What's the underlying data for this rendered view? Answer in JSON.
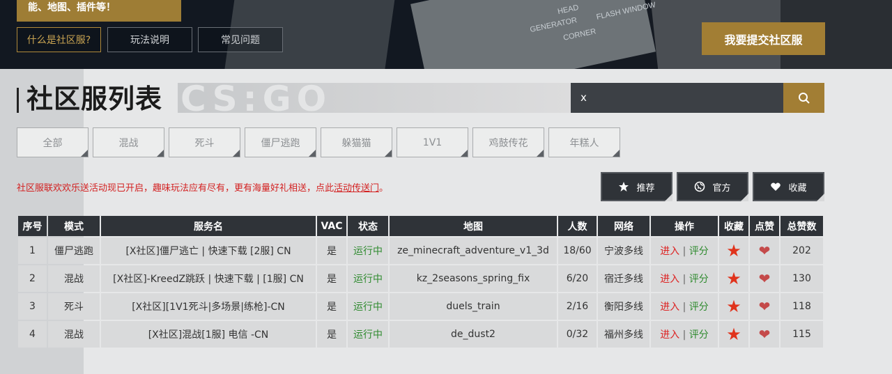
{
  "header": {
    "tagline": "能、地图、插件等！",
    "tabs": [
      "什么是社区服?",
      "玩法说明",
      "常见问题"
    ],
    "submit_label": "我要提交社区服",
    "room_labels": [
      "GENERATOR",
      "HEAD",
      "FLASH WINDOW",
      "CORNER"
    ]
  },
  "main": {
    "title": "社区服列表",
    "watermark": "CS:GO",
    "search": {
      "value": "x"
    },
    "filters": [
      "全部",
      "混战",
      "死斗",
      "僵尸逃跑",
      "躲猫猫",
      "1V1",
      "鸡鼓传花",
      "年糕人"
    ],
    "notice": {
      "text": "社区服联欢欢乐送活动现已开启，趣味玩法应有尽有，更有海量好礼相送，点此",
      "link": "活动传送门",
      "end": "。"
    },
    "actions": [
      {
        "label": "推荐",
        "icon": "star-icon"
      },
      {
        "label": "官方",
        "icon": "globe-icon"
      },
      {
        "label": "收藏",
        "icon": "heart-icon"
      }
    ]
  },
  "table": {
    "headers": [
      "序号",
      "模式",
      "服务名",
      "VAC",
      "状态",
      "地图",
      "人数",
      "网络",
      "操作",
      "收藏",
      "点赞",
      "总赞数"
    ],
    "enter_label": "进入",
    "rate_label": "评分",
    "rows": [
      {
        "no": "1",
        "mode": "僵尸逃跑",
        "name": "[X社区]僵尸逃亡 | 快速下载 [2服] CN",
        "vac": "是",
        "status": "运行中",
        "map": "ze_minecraft_adventure_v1_3d",
        "players": "18/60",
        "network": "宁波多线",
        "likes": "202"
      },
      {
        "no": "2",
        "mode": "混战",
        "name": "[X社区]-KreedZ跳跃 | 快速下载 | [1服] CN",
        "vac": "是",
        "status": "运行中",
        "map": "kz_2seasons_spring_fix",
        "players": "6/20",
        "network": "宿迁多线",
        "likes": "130"
      },
      {
        "no": "3",
        "mode": "死斗",
        "name": "[X社区][1V1死斗|多场景|练枪]-CN",
        "vac": "是",
        "status": "运行中",
        "map": "duels_train",
        "players": "2/16",
        "network": "衡阳多线",
        "likes": "118"
      },
      {
        "no": "4",
        "mode": "混战",
        "name": "[X社区]混战[1服] 电信 -CN",
        "vac": "是",
        "status": "运行中",
        "map": "de_dust2",
        "players": "0/32",
        "network": "福州多线",
        "likes": "115"
      }
    ]
  }
}
